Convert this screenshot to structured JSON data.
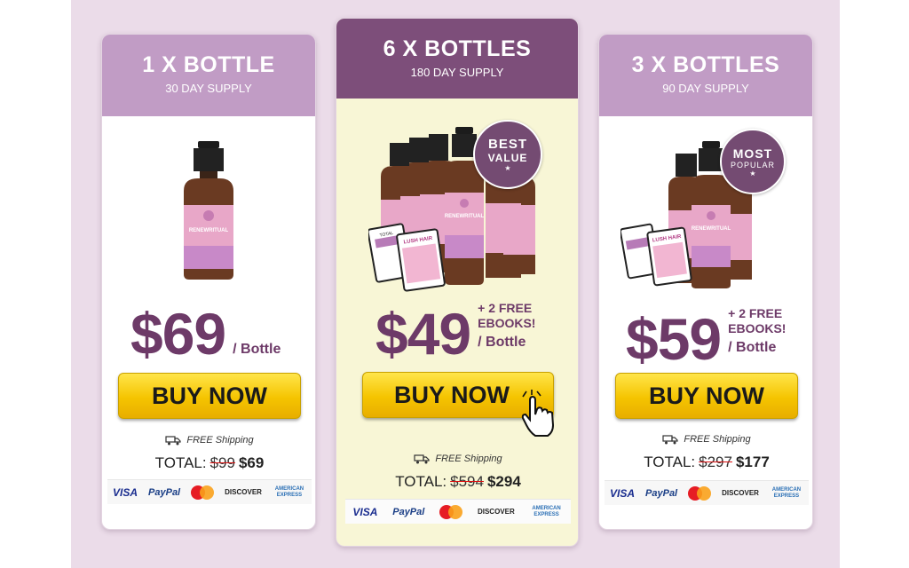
{
  "offers": [
    {
      "qty": "1 X BOTTLE",
      "supply": "30 DAY SUPPLY",
      "price": "$69",
      "per": "/ Bottle",
      "bonus": "",
      "buy_label": "BUY NOW",
      "shipping": "FREE Shipping",
      "total_label": "TOTAL:",
      "total_old": "$99",
      "total_new": "$69"
    },
    {
      "qty": "6 X BOTTLES",
      "supply": "180 DAY SUPPLY",
      "price": "$49",
      "per": "/ Bottle",
      "bonus_line1": "+ 2 FREE",
      "bonus_line2": "EBOOKS!",
      "badge_line1": "BEST",
      "badge_line2": "VALUE",
      "buy_label": "BUY NOW",
      "shipping": "FREE Shipping",
      "total_label": "TOTAL:",
      "total_old": "$594",
      "total_new": "$294",
      "ebook1_line1": "TOTAL",
      "ebook2_title": "LUSH HAIR"
    },
    {
      "qty": "3 X BOTTLES",
      "supply": "90 DAY SUPPLY",
      "price": "$59",
      "per": "/ Bottle",
      "bonus_line1": "+ 2 FREE",
      "bonus_line2": "EBOOKS!",
      "badge_line1": "MOST",
      "badge_line2": "POPULAR",
      "buy_label": "BUY NOW",
      "shipping": "FREE Shipping",
      "total_label": "TOTAL:",
      "total_old": "$297",
      "total_new": "$177",
      "ebook2_title": "LUSH HAIR"
    }
  ],
  "product": {
    "brand": "RENEWRITUAL"
  },
  "payment_methods": {
    "visa": "VISA",
    "paypal": "PayPal",
    "mastercard": "mastercard",
    "discover": "DISCOVER",
    "amex": "AMERICAN EXPRESS"
  },
  "colors": {
    "header": "#c19cc5",
    "header_featured": "#7d4e7a",
    "price": "#6d3a68",
    "button": "#f5c400",
    "featured_bg": "#f8f6d6"
  }
}
